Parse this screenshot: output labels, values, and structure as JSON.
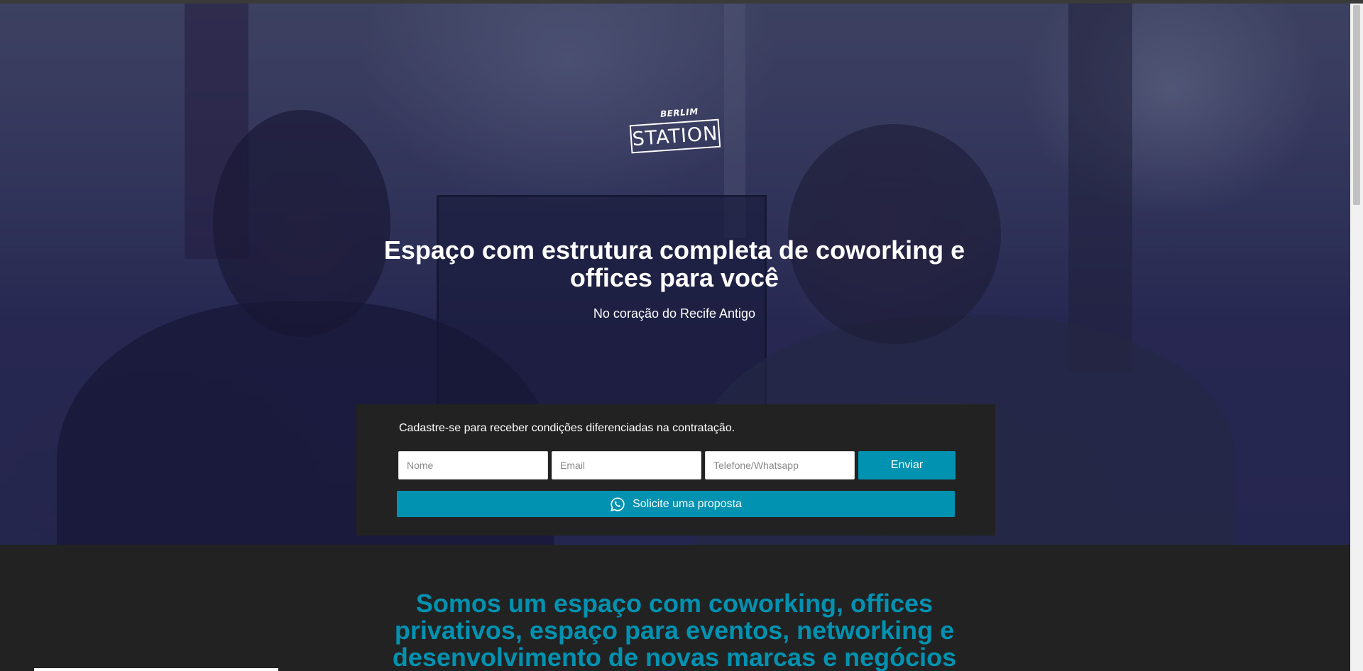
{
  "logo": {
    "top_text": "BERLIM",
    "main_text": "STATION"
  },
  "hero": {
    "headline": "Espaço com estrutura completa de coworking e offices para você",
    "subline": "No coração do Recife Antigo"
  },
  "form": {
    "intro": "Cadastre-se para receber condições diferenciadas na contratação.",
    "name_placeholder": "Nome",
    "email_placeholder": "Email",
    "phone_placeholder": "Telefone/Whatsapp",
    "submit_label": "Enviar",
    "proposal_label": "Solicite uma proposta",
    "proposal_icon": "whatsapp-icon"
  },
  "about": {
    "title": "Somos um espaço com coworking, offices privativos, espaço para eventos, networking e desenvolvimento de novas marcas e negócios"
  },
  "colors": {
    "accent": "#0092b0",
    "dark_bg": "#222222",
    "text": "#ffffff"
  }
}
